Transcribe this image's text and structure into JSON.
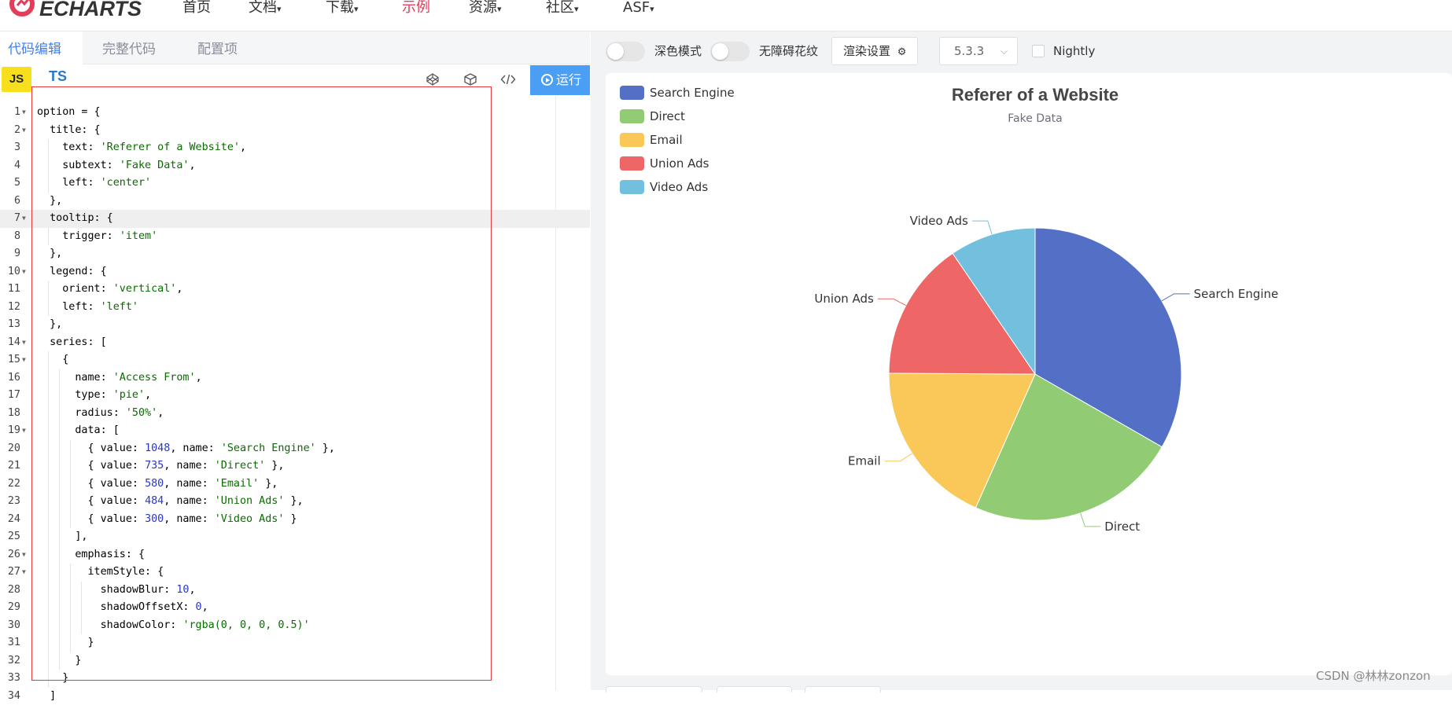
{
  "nav": {
    "logo_text": "ECHARTS",
    "items": [
      {
        "label": "首页",
        "caret": ""
      },
      {
        "label": "文档",
        "caret": "▾"
      },
      {
        "label": "下载",
        "caret": "▾"
      },
      {
        "label": "示例",
        "caret": ""
      },
      {
        "label": "资源",
        "caret": "▾"
      },
      {
        "label": "社区",
        "caret": "▾"
      },
      {
        "label": "ASF",
        "caret": "▾"
      }
    ],
    "active_index": 3,
    "active_color": "#e43c59"
  },
  "editor": {
    "tabs": [
      {
        "label": "代码编辑",
        "active": true
      },
      {
        "label": "完整代码",
        "active": false
      },
      {
        "label": "配置项",
        "active": false
      }
    ],
    "js_label": "JS",
    "ts_label": "TS",
    "run_label": "运行",
    "tool_icons": [
      "codepen-icon",
      "codesandbox-icon",
      "code-icon"
    ],
    "highlighted_line": 7,
    "lines": [
      "option = {",
      "  title: {",
      "    text: 'Referer of a Website',",
      "    subtext: 'Fake Data',",
      "    left: 'center'",
      "  },",
      "  tooltip: {",
      "    trigger: 'item'",
      "  },",
      "  legend: {",
      "    orient: 'vertical',",
      "    left: 'left'",
      "  },",
      "  series: [",
      "    {",
      "      name: 'Access From',",
      "      type: 'pie',",
      "      radius: '50%',",
      "      data: [",
      "        { value: 1048, name: 'Search Engine' },",
      "        { value: 735, name: 'Direct' },",
      "        { value: 580, name: 'Email' },",
      "        { value: 484, name: 'Union Ads' },",
      "        { value: 300, name: 'Video Ads' }",
      "      ],",
      "      emphasis: {",
      "        itemStyle: {",
      "          shadowBlur: 10,",
      "          shadowOffsetX: 0,",
      "          shadowColor: 'rgba(0, 0, 0, 0.5)'",
      "        }",
      "      }",
      "    }",
      "  ]"
    ],
    "foldable_lines": [
      1,
      2,
      7,
      10,
      14,
      15,
      19,
      26,
      27
    ]
  },
  "preview_toolbar": {
    "dark_mode_label": "深色模式",
    "aria_label": "无障碍花纹",
    "render_settings_label": "渲染设置",
    "version": "5.3.3",
    "nightly_label": "Nightly"
  },
  "chart_data": {
    "type": "pie",
    "title": "Referer of a Website",
    "subtitle": "Fake Data",
    "legend_position": "top-left",
    "legend_orient": "vertical",
    "series_name": "Access From",
    "radius": "50%",
    "slices": [
      {
        "name": "Search Engine",
        "value": 1048,
        "color": "#5470c6"
      },
      {
        "name": "Direct",
        "value": 735,
        "color": "#91cc75"
      },
      {
        "name": "Email",
        "value": 580,
        "color": "#fac858"
      },
      {
        "name": "Union Ads",
        "value": 484,
        "color": "#ee6666"
      },
      {
        "name": "Video Ads",
        "value": 300,
        "color": "#73c0de"
      }
    ]
  },
  "watermark": "CSDN @林林zonzon"
}
